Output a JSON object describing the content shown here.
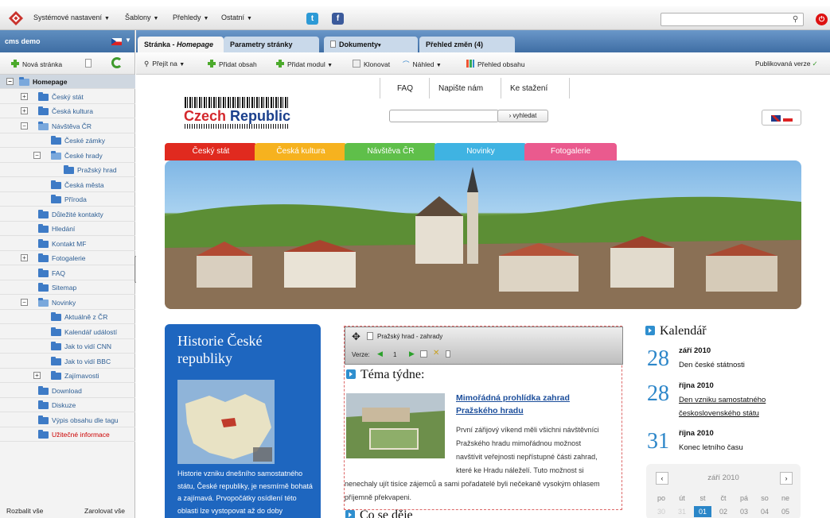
{
  "topbar": {
    "menu": [
      {
        "label": "Systémové nastavení"
      },
      {
        "label": "Šablony"
      },
      {
        "label": "Přehledy"
      },
      {
        "label": "Ostatní"
      }
    ],
    "social": [
      "t",
      "f"
    ],
    "search_placeholder": ""
  },
  "sidebar": {
    "site_label": "cms demo",
    "new_page_label": "Nová stránka",
    "tree": [
      {
        "label": "Homepage",
        "level": 0,
        "toggle": "−",
        "open": true,
        "selected": true
      },
      {
        "label": "Český stát",
        "level": 1,
        "toggle": "+"
      },
      {
        "label": "Česká kultura",
        "level": 1,
        "toggle": "+"
      },
      {
        "label": "Návštěva ČR",
        "level": 1,
        "toggle": "−",
        "open": true
      },
      {
        "label": "České zámky",
        "level": 2
      },
      {
        "label": "České hrady",
        "level": 2,
        "toggle": "−",
        "open": true
      },
      {
        "label": "Pražský hrad",
        "level": 3
      },
      {
        "label": "Česká města",
        "level": 2
      },
      {
        "label": "Příroda",
        "level": 2
      },
      {
        "label": "Důležité kontakty",
        "level": 1
      },
      {
        "label": "Hledání",
        "level": 1
      },
      {
        "label": "Kontakt MF",
        "level": 1
      },
      {
        "label": "Fotogalerie",
        "level": 1,
        "toggle": "+"
      },
      {
        "label": "FAQ",
        "level": 1
      },
      {
        "label": "Sitemap",
        "level": 1
      },
      {
        "label": "Novinky",
        "level": 1,
        "toggle": "−",
        "open": true
      },
      {
        "label": "Aktuálně z ČR",
        "level": 2
      },
      {
        "label": "Kalendář událostí",
        "level": 2
      },
      {
        "label": "Jak to vidí CNN",
        "level": 2
      },
      {
        "label": "Jak to vidí BBC",
        "level": 2
      },
      {
        "label": "Zajímavosti",
        "level": 2,
        "toggle": "+"
      },
      {
        "label": "Download",
        "level": 1
      },
      {
        "label": "Diskuze",
        "level": 1
      },
      {
        "label": "Výpis obsahu dle tagu",
        "level": 1
      },
      {
        "label": "Užitečné informace",
        "level": 1,
        "red": true
      }
    ],
    "expand_all": "Rozbalit vše",
    "collapse_all": "Zarolovat vše"
  },
  "tabs": [
    {
      "prefix": "Stránka - ",
      "label": "Homepage"
    },
    {
      "label": "Parametry stránky"
    },
    {
      "label": "Dokumenty"
    },
    {
      "label": "Přehled změn (4)"
    }
  ],
  "toolbar": {
    "goto": "Přejít na",
    "add_content": "Přidat obsah",
    "add_module": "Přidat modul",
    "clone": "Klonovat",
    "preview": "Náhled",
    "content_overview": "Přehled obsahu",
    "published": "Publikovaná verze"
  },
  "site": {
    "nav": [
      "FAQ",
      "Napište nám",
      "Ke stažení"
    ],
    "brand1": "Czech",
    "brand2": " Republic",
    "search_button": "› vyhledat",
    "nav_tabs": [
      {
        "label": "Český stát",
        "color": "#e02a1f"
      },
      {
        "label": "Česká kultura",
        "color": "#f6b21f"
      },
      {
        "label": "Návštěva ČR",
        "color": "#5fbf4a"
      },
      {
        "label": "Novinky",
        "color": "#3fb3e2"
      },
      {
        "label": "Fotogalerie",
        "color": "#ea5a8e"
      }
    ],
    "history_title": "Historie České republiky",
    "history_text": "Historie vzniku dnešního samostatného státu, České republiky, je nesmírně bohatá a zajímavá. Prvopočátky osídlení této oblasti lze vystopovat až do doby",
    "widget": {
      "module_name": "Pražský hrad - zahrady",
      "version_label": "Verze:",
      "version_value": "1",
      "topic_heading": "Téma týdne:",
      "article_title": "Mimořádná prohlídka zahrad Pražského hradu",
      "article_lines": [
        "První zářijový víkend měli všichni návštěvníci",
        "Pražského hradu mimořádnou možnost",
        "navštívit veřejnosti nepřístupné části zahrad,",
        "které ke Hradu náleželí. Tuto možnost si"
      ],
      "article_tail": "nenechaly ujít tisíce zájemců a sami pořadatelé byli nečekaně vysokým ohlasem příjemně překvapeni.",
      "next_heading": "Co se děje"
    },
    "calendar": {
      "heading": "Kalendář",
      "events": [
        {
          "day": "28",
          "month": "září 2010",
          "text": "Den české státnosti",
          "link": false
        },
        {
          "day": "28",
          "month": "října 2010",
          "text": "Den vzniku samostatného československého státu",
          "link": true
        },
        {
          "day": "31",
          "month": "října 2010",
          "text": "Konec letního času",
          "link": false
        }
      ],
      "month_label": "září 2010",
      "prev": "‹",
      "next": "›",
      "weekdays": [
        "po",
        "út",
        "st",
        "čt",
        "pá",
        "so",
        "ne"
      ],
      "days": [
        {
          "d": "30",
          "dim": true
        },
        {
          "d": "31",
          "dim": true
        },
        {
          "d": "01",
          "selected": true
        },
        {
          "d": "02"
        },
        {
          "d": "03"
        },
        {
          "d": "04"
        },
        {
          "d": "05"
        }
      ]
    }
  },
  "colors": {
    "accent_blue": "#3f6ea4",
    "history_bg": "#1e66bf",
    "calendar_number": "#2c86c9",
    "link": "#1c4e9b"
  }
}
